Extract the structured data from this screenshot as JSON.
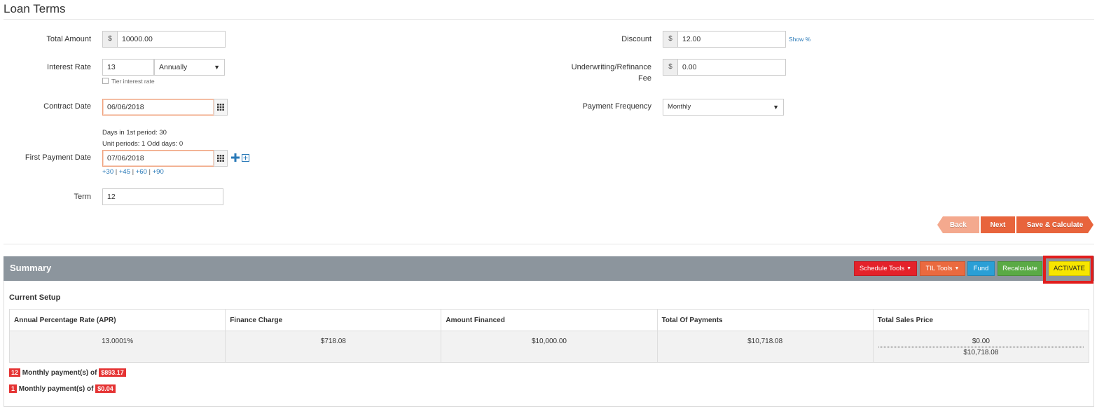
{
  "page": {
    "title": "Loan Terms"
  },
  "form": {
    "total_amount": {
      "label": "Total Amount",
      "prefix": "$",
      "value": "10000.00"
    },
    "interest_rate": {
      "label": "Interest Rate",
      "value": "13",
      "period": "Annually",
      "tier_label": "Tier interest rate"
    },
    "contract_date": {
      "label": "Contract Date",
      "value": "06/06/2018"
    },
    "period_info": {
      "days_first": "Days in 1st period: 30",
      "unit_periods": "Unit periods: 1 Odd days: 0"
    },
    "first_payment_date": {
      "label": "First Payment Date",
      "value": "07/06/2018",
      "quick_links": [
        "+30",
        "+45",
        "+60",
        "+90"
      ]
    },
    "term": {
      "label": "Term",
      "value": "12"
    },
    "discount": {
      "label": "Discount",
      "prefix": "$",
      "value": "12.00",
      "show_pct": "Show %"
    },
    "underwriting_fee": {
      "label_line1": "Underwriting/Refinance",
      "label_line2": "Fee",
      "prefix": "$",
      "value": "0.00"
    },
    "payment_frequency": {
      "label": "Payment Frequency",
      "value": "Monthly"
    }
  },
  "nav": {
    "back": "Back",
    "next": "Next",
    "save": "Save & Calculate"
  },
  "summary": {
    "title": "Summary",
    "buttons": {
      "schedule_tools": "Schedule Tools",
      "til_tools": "TIL Tools",
      "fund": "Fund",
      "recalculate": "Recalculate",
      "activate": "ACTIVATE"
    },
    "current_setup": "Current Setup",
    "columns": [
      "Annual Percentage Rate (APR)",
      "Finance Charge",
      "Amount Financed",
      "Total Of Payments",
      "Total Sales Price"
    ],
    "values": [
      "13.0001%",
      "$718.08",
      "$10,000.00",
      "$10,718.08"
    ],
    "sales_price_top": "$0.00",
    "sales_price_bottom": "$10,718.08",
    "payments": [
      {
        "count": "12",
        "text": "Monthly payment(s) of",
        "amount": "$893.17"
      },
      {
        "count": "1",
        "text": "Monthly payment(s) of",
        "amount": "$0.04"
      }
    ]
  },
  "colors": {
    "accent_orange": "#e8643c",
    "schedule_red": "#e4222a",
    "til_orange": "#ea6a3f",
    "fund_blue": "#2a9fd6",
    "recalc_green": "#5aaa45",
    "activate_yellow": "#f7e500",
    "highlight_red": "#e11d1d"
  }
}
